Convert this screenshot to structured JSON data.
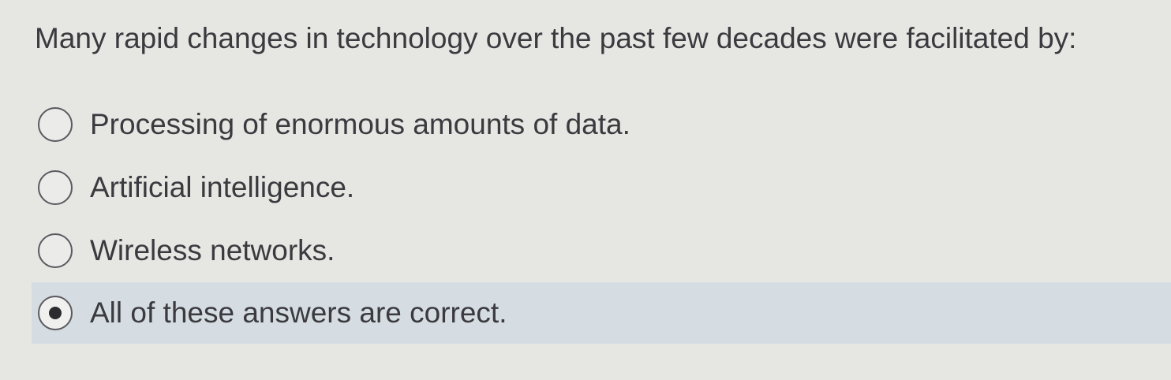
{
  "question": {
    "text": "Many rapid changes in technology over the past few decades were facilitated by:"
  },
  "options": [
    {
      "label": "Processing of enormous amounts of data.",
      "selected": false
    },
    {
      "label": "Artificial intelligence.",
      "selected": false
    },
    {
      "label": "Wireless networks.",
      "selected": false
    },
    {
      "label": "All of these answers are correct.",
      "selected": true
    }
  ],
  "colors": {
    "background": "#e6e6e3",
    "selected_row": "#d6dde2",
    "text": "#3a3a3f"
  }
}
